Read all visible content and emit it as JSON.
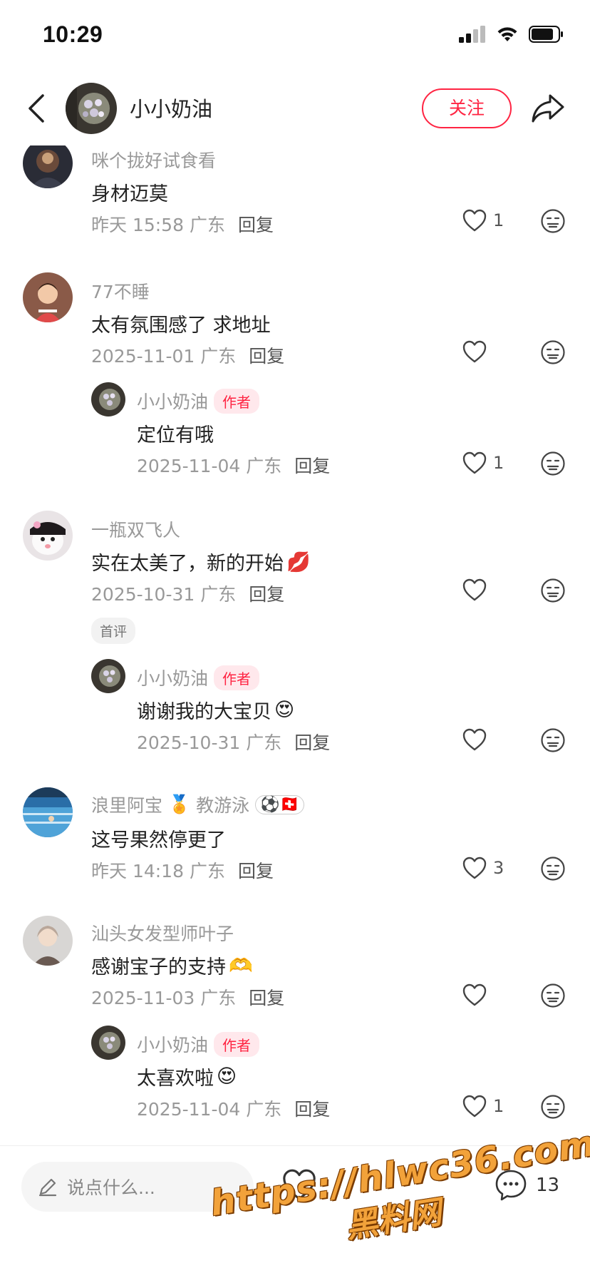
{
  "status_bar": {
    "time": "10:29"
  },
  "header": {
    "name": "小小奶油",
    "follow_label": "关注"
  },
  "comments": [
    {
      "user": "咪个拢好试食看",
      "text": "身材迈莫",
      "date": "昨天 15:58 广东",
      "reply": "回复",
      "likes": "1"
    },
    {
      "user": "77不睡",
      "text": "太有氛围感了 求地址",
      "date": "2025-11-01 广东",
      "reply": "回复",
      "likes": "",
      "replies": [
        {
          "user": "小小奶油",
          "tag": "作者",
          "text": "定位有哦",
          "date": "2025-11-04 广东",
          "reply": "回复",
          "likes": "1"
        }
      ]
    },
    {
      "user": "一瓶双飞人",
      "text": "实在太美了，新的开始",
      "text_emoji": "💋",
      "date": "2025-10-31 广东",
      "reply": "回复",
      "likes": "",
      "badge": "首评",
      "replies": [
        {
          "user": "小小奶油",
          "tag": "作者",
          "text": "谢谢我的大宝贝",
          "text_emoji": "😍",
          "date": "2025-10-31 广东",
          "reply": "回复",
          "likes": ""
        }
      ]
    },
    {
      "user": "浪里阿宝",
      "user_emoji": "🏅",
      "user_suffix": "教游泳",
      "user_badge": "⚽🇨🇭",
      "text": "这号果然停更了",
      "date": "昨天 14:18 广东",
      "reply": "回复",
      "likes": "3"
    },
    {
      "user": "汕头女发型师叶子",
      "text": "感谢宝子的支持",
      "text_emoji": "🫶",
      "date": "2025-11-03 广东",
      "reply": "回复",
      "likes": "",
      "replies": [
        {
          "user": "小小奶油",
          "tag": "作者",
          "text": "太喜欢啦",
          "text_emoji": "😍",
          "date": "2025-11-04 广东",
          "reply": "回复",
          "likes": "1"
        }
      ]
    }
  ],
  "bottom_bar": {
    "input_placeholder": "说点什么...",
    "comment_count": "13"
  },
  "watermark": {
    "line1": "https://hlwc36.com",
    "line2": "黑料网"
  },
  "colors": {
    "accent": "#ff2442",
    "muted": "#999999"
  }
}
